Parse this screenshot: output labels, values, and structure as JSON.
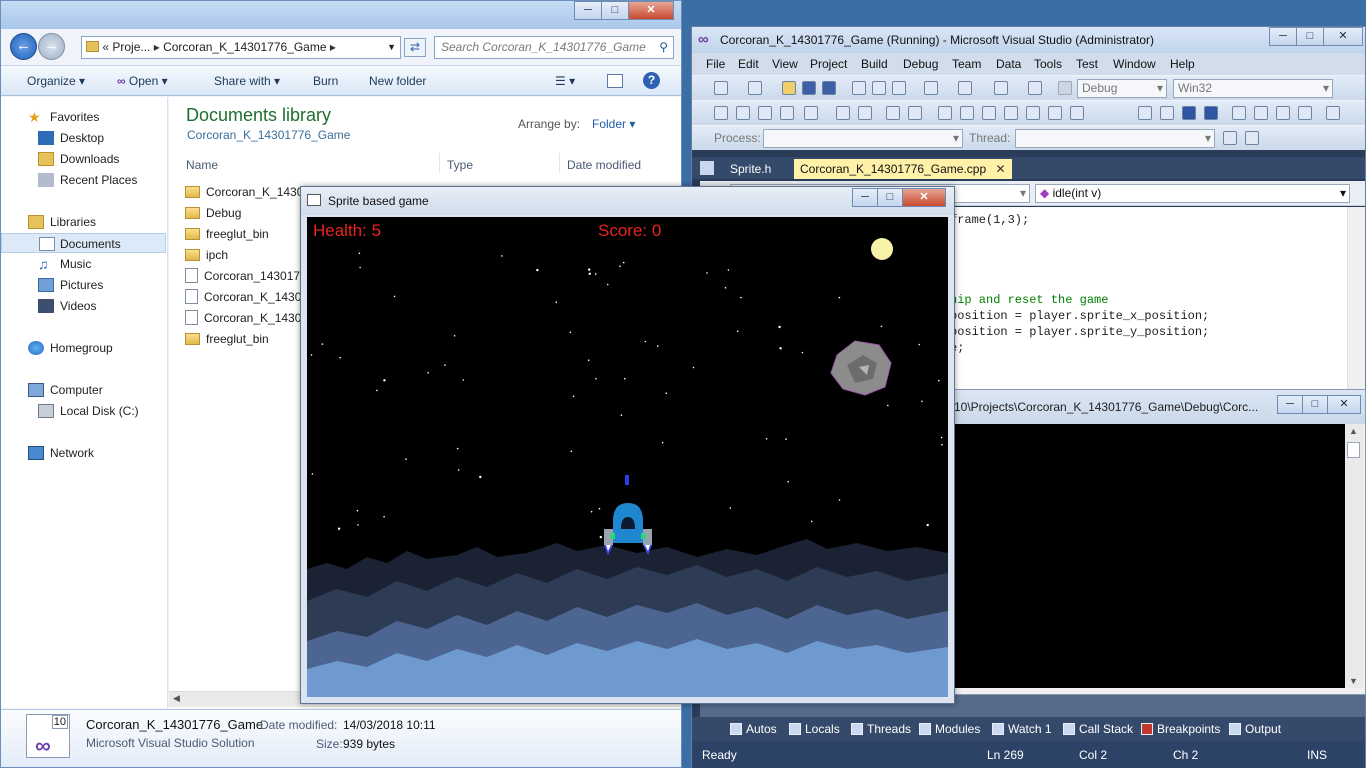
{
  "explorer": {
    "address": [
      "Proje...",
      "Corcoran_K_14301776_Game"
    ],
    "search_placeholder": "Search Corcoran_K_14301776_Game",
    "toolbar": {
      "organize": "Organize",
      "open": "Open",
      "share_with": "Share with",
      "burn": "Burn",
      "new_folder": "New folder"
    },
    "nav": {
      "favorites": "Favorites",
      "desktop": "Desktop",
      "downloads": "Downloads",
      "recent_places": "Recent Places",
      "libraries": "Libraries",
      "documents": "Documents",
      "music": "Music",
      "pictures": "Pictures",
      "videos": "Videos",
      "homegroup": "Homegroup",
      "computer": "Computer",
      "local_disk": "Local Disk (C:)",
      "network": "Network"
    },
    "library_title": "Documents library",
    "library_subtitle": "Corcoran_K_14301776_Game",
    "arrange_label": "Arrange by:",
    "arrange_value": "Folder",
    "columns": {
      "name": "Name",
      "type": "Type",
      "date": "Date modified"
    },
    "files": [
      "Corcoran_K_1430",
      "Debug",
      "freeglut_bin",
      "ipch",
      "Corcoran_143017",
      "Corcoran_K_1430",
      "Corcoran_K_1430",
      "freeglut_bin"
    ],
    "details": {
      "name": "Corcoran_K_14301776_Game",
      "type": "Microsoft Visual Studio Solution",
      "date_label": "Date modified:",
      "date_value": "14/03/2018 10:11",
      "size_label": "Size:",
      "size_value": "939 bytes",
      "icon_version": "10"
    }
  },
  "vs": {
    "title": "Corcoran_K_14301776_Game (Running) - Microsoft Visual Studio (Administrator)",
    "menu": [
      "File",
      "Edit",
      "View",
      "Project",
      "Build",
      "Debug",
      "Team",
      "Data",
      "Tools",
      "Test",
      "Window",
      "Help"
    ],
    "config": "Debug",
    "platform": "Win32",
    "process_label": "Process:",
    "thread_label": "Thread:",
    "tabs": {
      "sprite_h": "Sprite.h",
      "game_cpp": "Corcoran_K_14301776_Game.cpp"
    },
    "member_combo": "idle(int v)",
    "code": [
      "frame(1,3);",
      "hip and reset the game",
      "position = player.sprite_x_position;",
      "position = player.sprite_y_position;",
      "e;",
      ";"
    ],
    "bottom_tabs": [
      "Autos",
      "Locals",
      "Threads",
      "Modules",
      "Watch 1",
      "Call Stack",
      "Breakpoints",
      "Output"
    ],
    "status": {
      "ready": "Ready",
      "ln": "Ln 269",
      "col": "Col 2",
      "ch": "Ch 2",
      "ins": "INS"
    }
  },
  "console": {
    "title": "10\\Projects\\Corcoran_K_14301776_Game\\Debug\\Corc..."
  },
  "game": {
    "title": "Sprite based game",
    "health_label": "Health: 5",
    "score_label": "Score: 0"
  }
}
